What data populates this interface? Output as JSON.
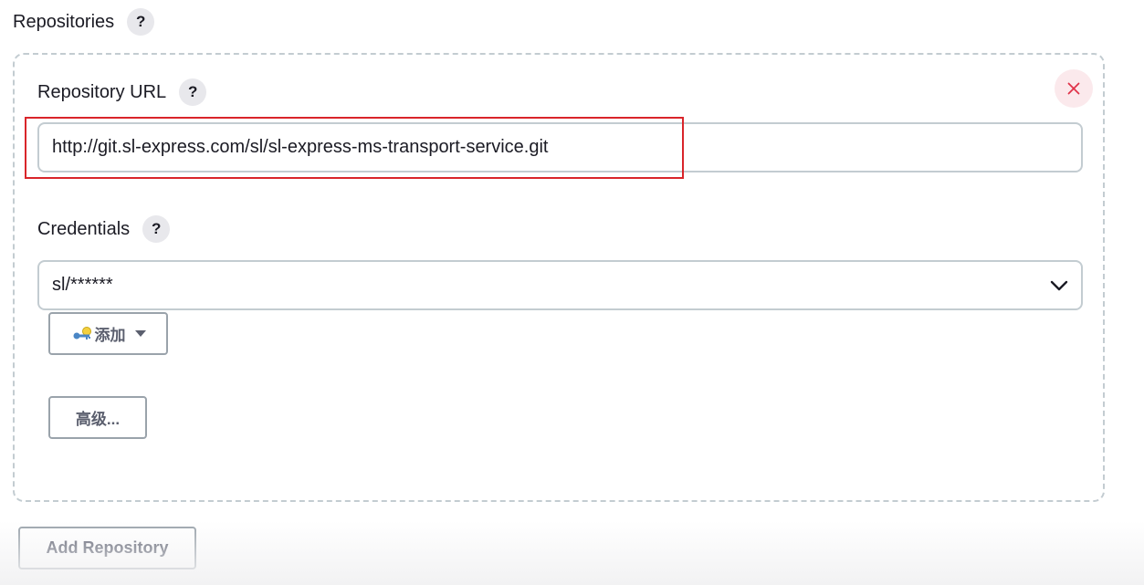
{
  "section": {
    "title": "Repositories",
    "help": "?"
  },
  "repository": {
    "url_label": "Repository URL",
    "url_help": "?",
    "url_value": "http://git.sl-express.com/sl/sl-express-ms-transport-service.git",
    "credentials_label": "Credentials",
    "credentials_help": "?",
    "credentials_value": "sl/******",
    "add_button": "添加",
    "advanced_button": "高级...",
    "remove_icon": "close-icon"
  },
  "footer": {
    "add_repository_button": "Add Repository"
  },
  "colors": {
    "highlight": "#d9252a",
    "close_icon": "#e0334a",
    "border": "#c3ccd1",
    "button_text": "#5b5f6e"
  }
}
